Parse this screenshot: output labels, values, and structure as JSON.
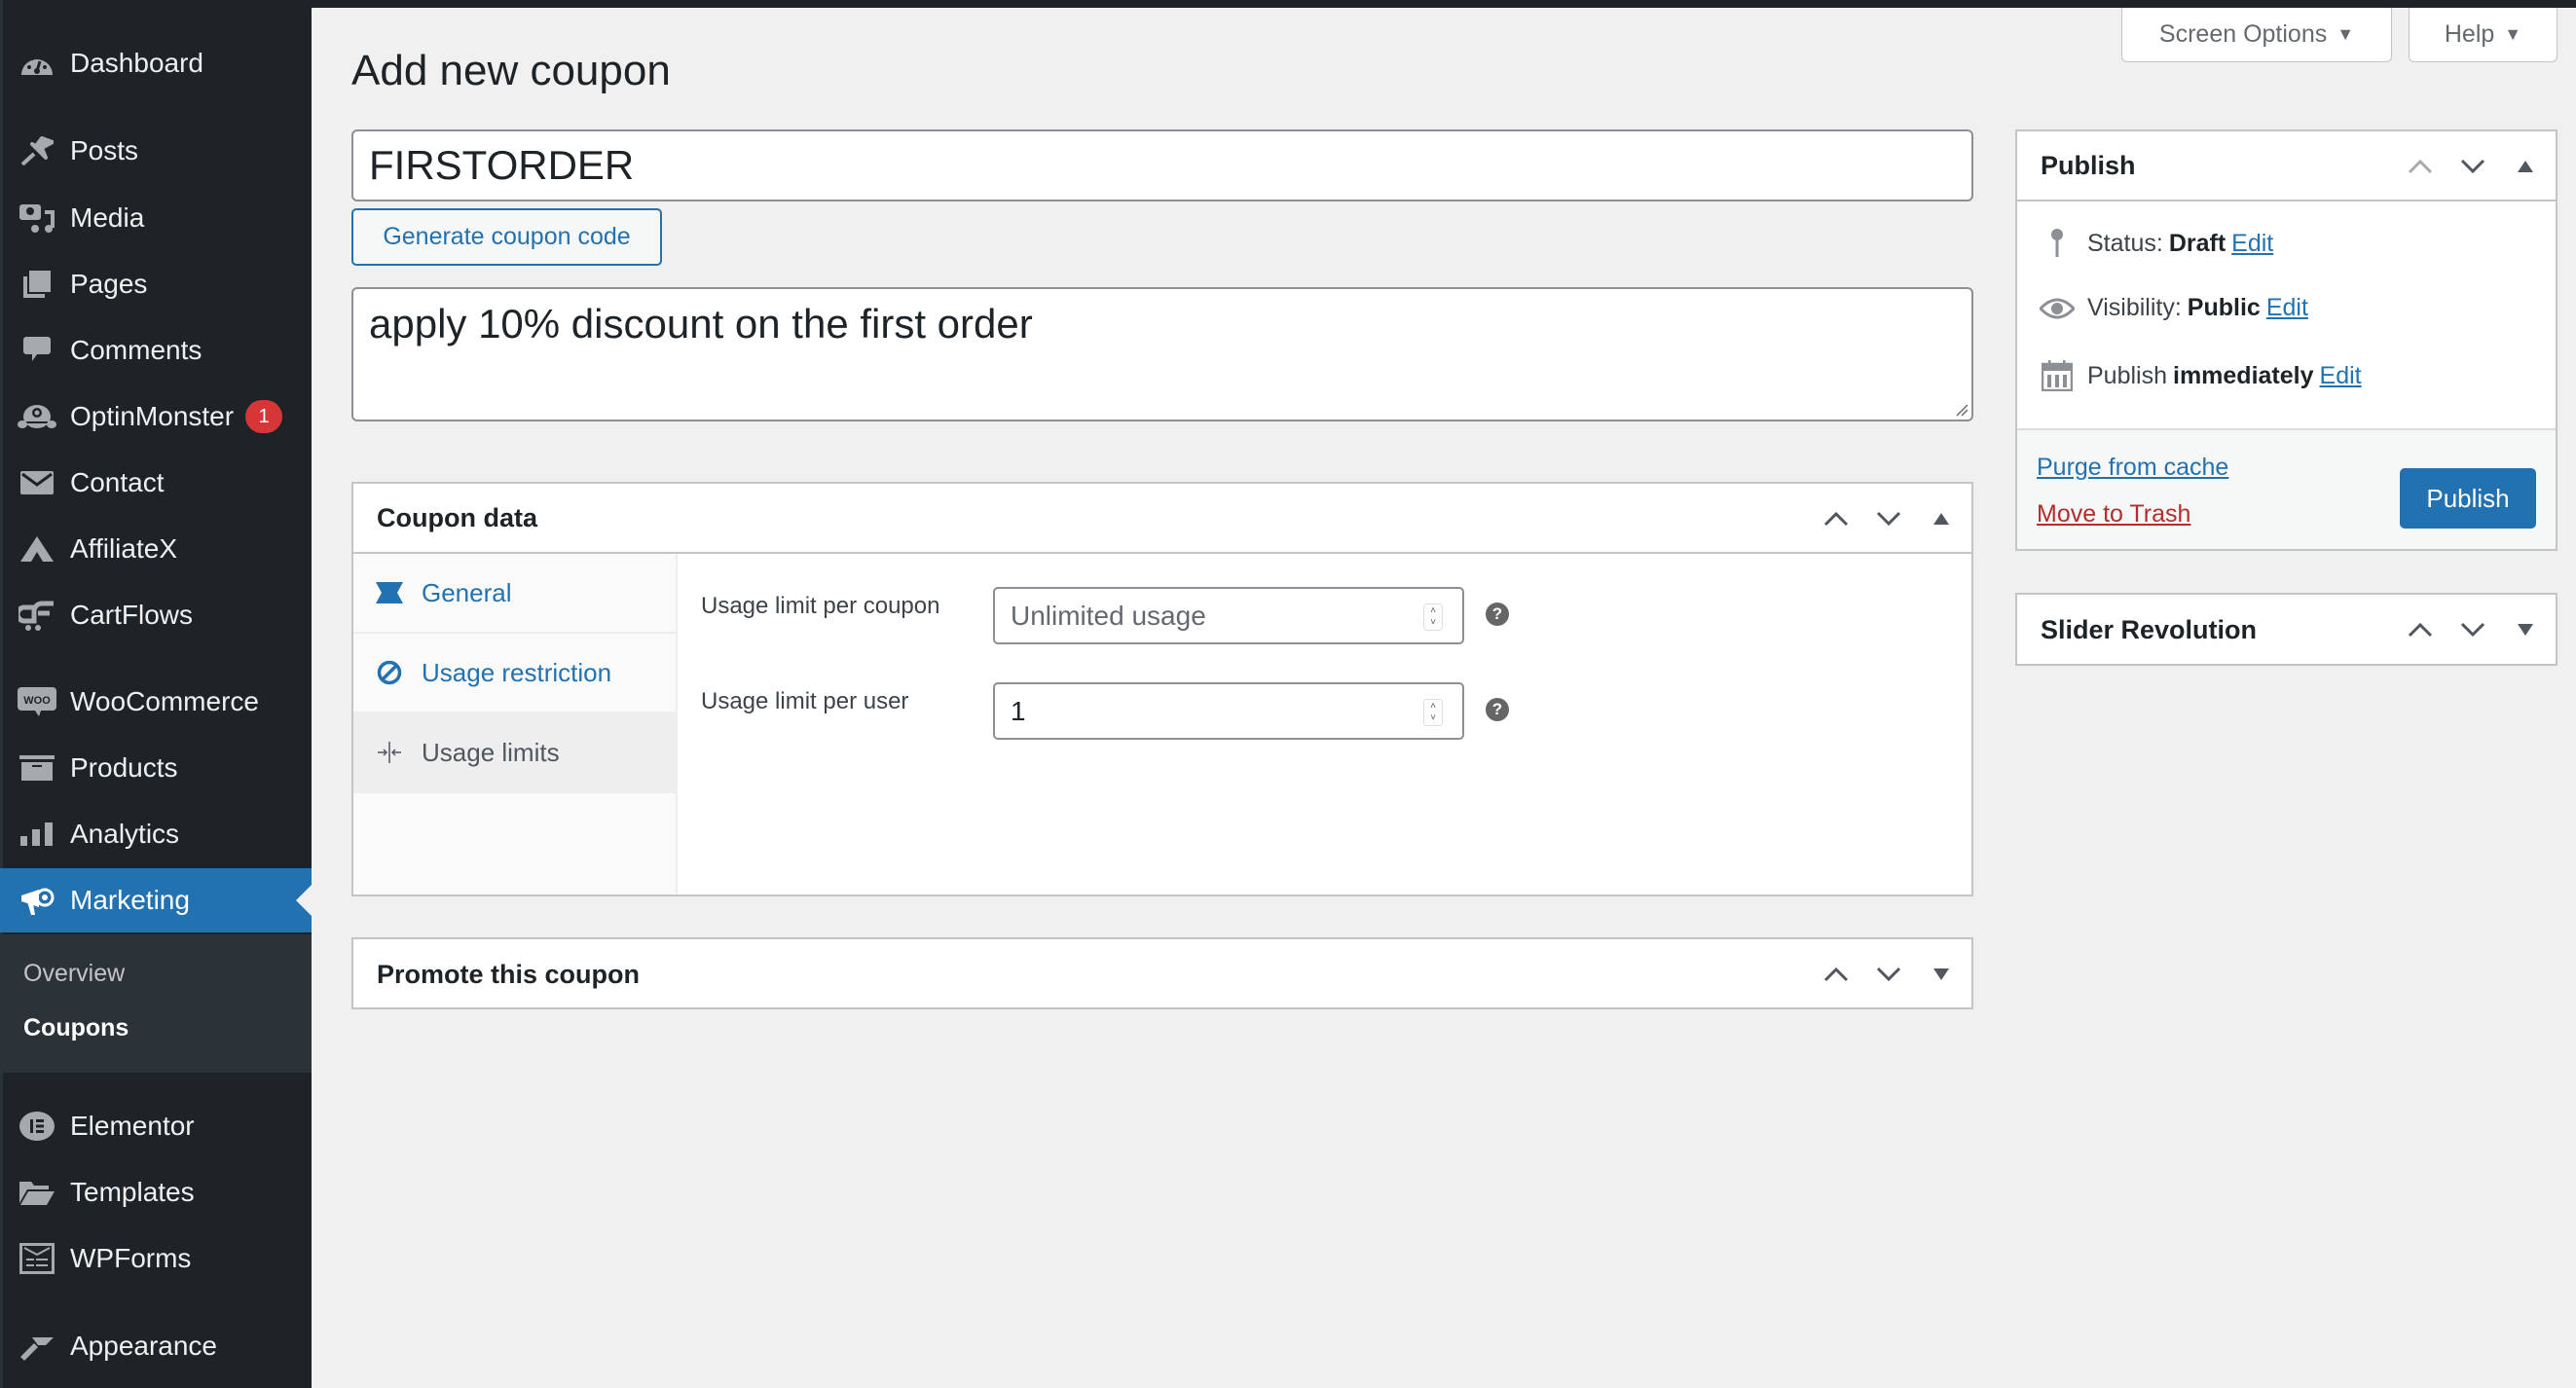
{
  "sidebar": {
    "items": [
      {
        "label": "Dashboard",
        "icon": "dashboard-icon"
      },
      {
        "label": "Posts",
        "icon": "pushpin-icon"
      },
      {
        "label": "Media",
        "icon": "media-icon"
      },
      {
        "label": "Pages",
        "icon": "pages-icon"
      },
      {
        "label": "Comments",
        "icon": "comment-icon"
      },
      {
        "label": "OptinMonster",
        "icon": "optinmonster-icon",
        "badge": "1"
      },
      {
        "label": "Contact",
        "icon": "envelope-icon"
      },
      {
        "label": "AffiliateX",
        "icon": "affiliatex-icon"
      },
      {
        "label": "CartFlows",
        "icon": "cartflows-icon"
      },
      {
        "label": "WooCommerce",
        "icon": "woo-icon"
      },
      {
        "label": "Products",
        "icon": "archive-icon"
      },
      {
        "label": "Analytics",
        "icon": "bar-chart-icon"
      },
      {
        "label": "Marketing",
        "icon": "megaphone-icon",
        "active": true
      },
      {
        "label": "Elementor",
        "icon": "elementor-icon"
      },
      {
        "label": "Templates",
        "icon": "folder-icon"
      },
      {
        "label": "WPForms",
        "icon": "wpforms-icon"
      },
      {
        "label": "Appearance",
        "icon": "paintbrush-icon"
      }
    ],
    "submenu": [
      {
        "label": "Overview"
      },
      {
        "label": "Coupons",
        "current": true
      }
    ]
  },
  "header": {
    "screen_options": "Screen Options",
    "help": "Help"
  },
  "page": {
    "title": "Add new coupon",
    "coupon_code": "FIRSTORDER",
    "generate_button": "Generate coupon code",
    "description": "apply 10% discount on the first order"
  },
  "coupon_data": {
    "title": "Coupon data",
    "tabs": [
      {
        "label": "General",
        "icon": "ticket-icon"
      },
      {
        "label": "Usage restriction",
        "icon": "block-icon"
      },
      {
        "label": "Usage limits",
        "icon": "limits-icon",
        "active": true
      }
    ],
    "fields": [
      {
        "label": "Usage limit per coupon",
        "value": "",
        "placeholder": "Unlimited usage"
      },
      {
        "label": "Usage limit per user",
        "value": "1",
        "placeholder": ""
      }
    ],
    "help_glyph": "?"
  },
  "promote": {
    "title": "Promote this coupon"
  },
  "publish": {
    "title": "Publish",
    "status_label": "Status:",
    "status_value": "Draft",
    "visibility_label": "Visibility:",
    "visibility_value": "Public",
    "publish_label": "Publish",
    "publish_value": "immediately",
    "edit_link": "Edit",
    "purge_link": "Purge from cache",
    "trash_link": "Move to Trash",
    "publish_button": "Publish"
  },
  "slider_revolution": {
    "title": "Slider Revolution"
  },
  "colors": {
    "sidebar_bg": "#1d2327",
    "accent": "#2271b1",
    "trash": "#b32d2e",
    "badge": "#d63638"
  }
}
